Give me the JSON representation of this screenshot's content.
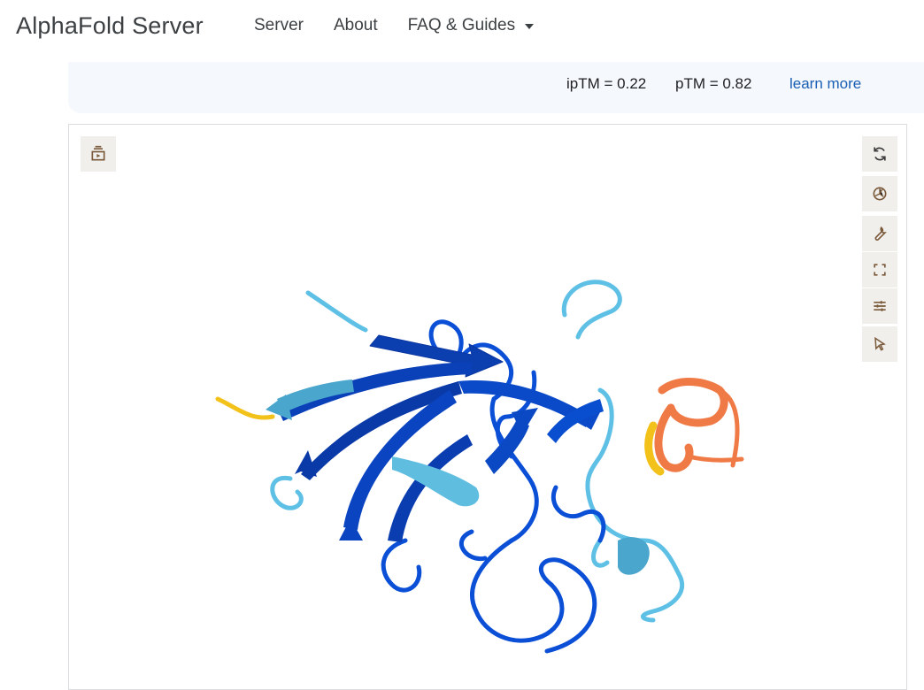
{
  "header": {
    "brand": "AlphaFold Server",
    "nav": [
      {
        "label": "Server"
      },
      {
        "label": "About"
      },
      {
        "label": "FAQ & Guides",
        "has_dropdown": true
      }
    ]
  },
  "metrics": {
    "iptm": "ipTM = 0.22",
    "ptm": "pTM = 0.82",
    "learn_more": "learn more"
  },
  "viewer": {
    "left_toolbar": [
      {
        "icon": "playback-icon"
      }
    ],
    "right_toolbar": [
      {
        "icon": "reset-rotation-icon"
      },
      {
        "icon": "screenshot-icon"
      },
      {
        "icon": "wrench-icon"
      },
      {
        "icon": "fullscreen-icon"
      },
      {
        "icon": "settings-sliders-icon"
      },
      {
        "icon": "cursor-select-icon"
      }
    ],
    "colors": {
      "very_high": "#0a4fd6",
      "confident": "#0055b3",
      "low": "#5fc0e6",
      "very_low_orange": "#f07a45",
      "yellow": "#f2c21b"
    }
  }
}
